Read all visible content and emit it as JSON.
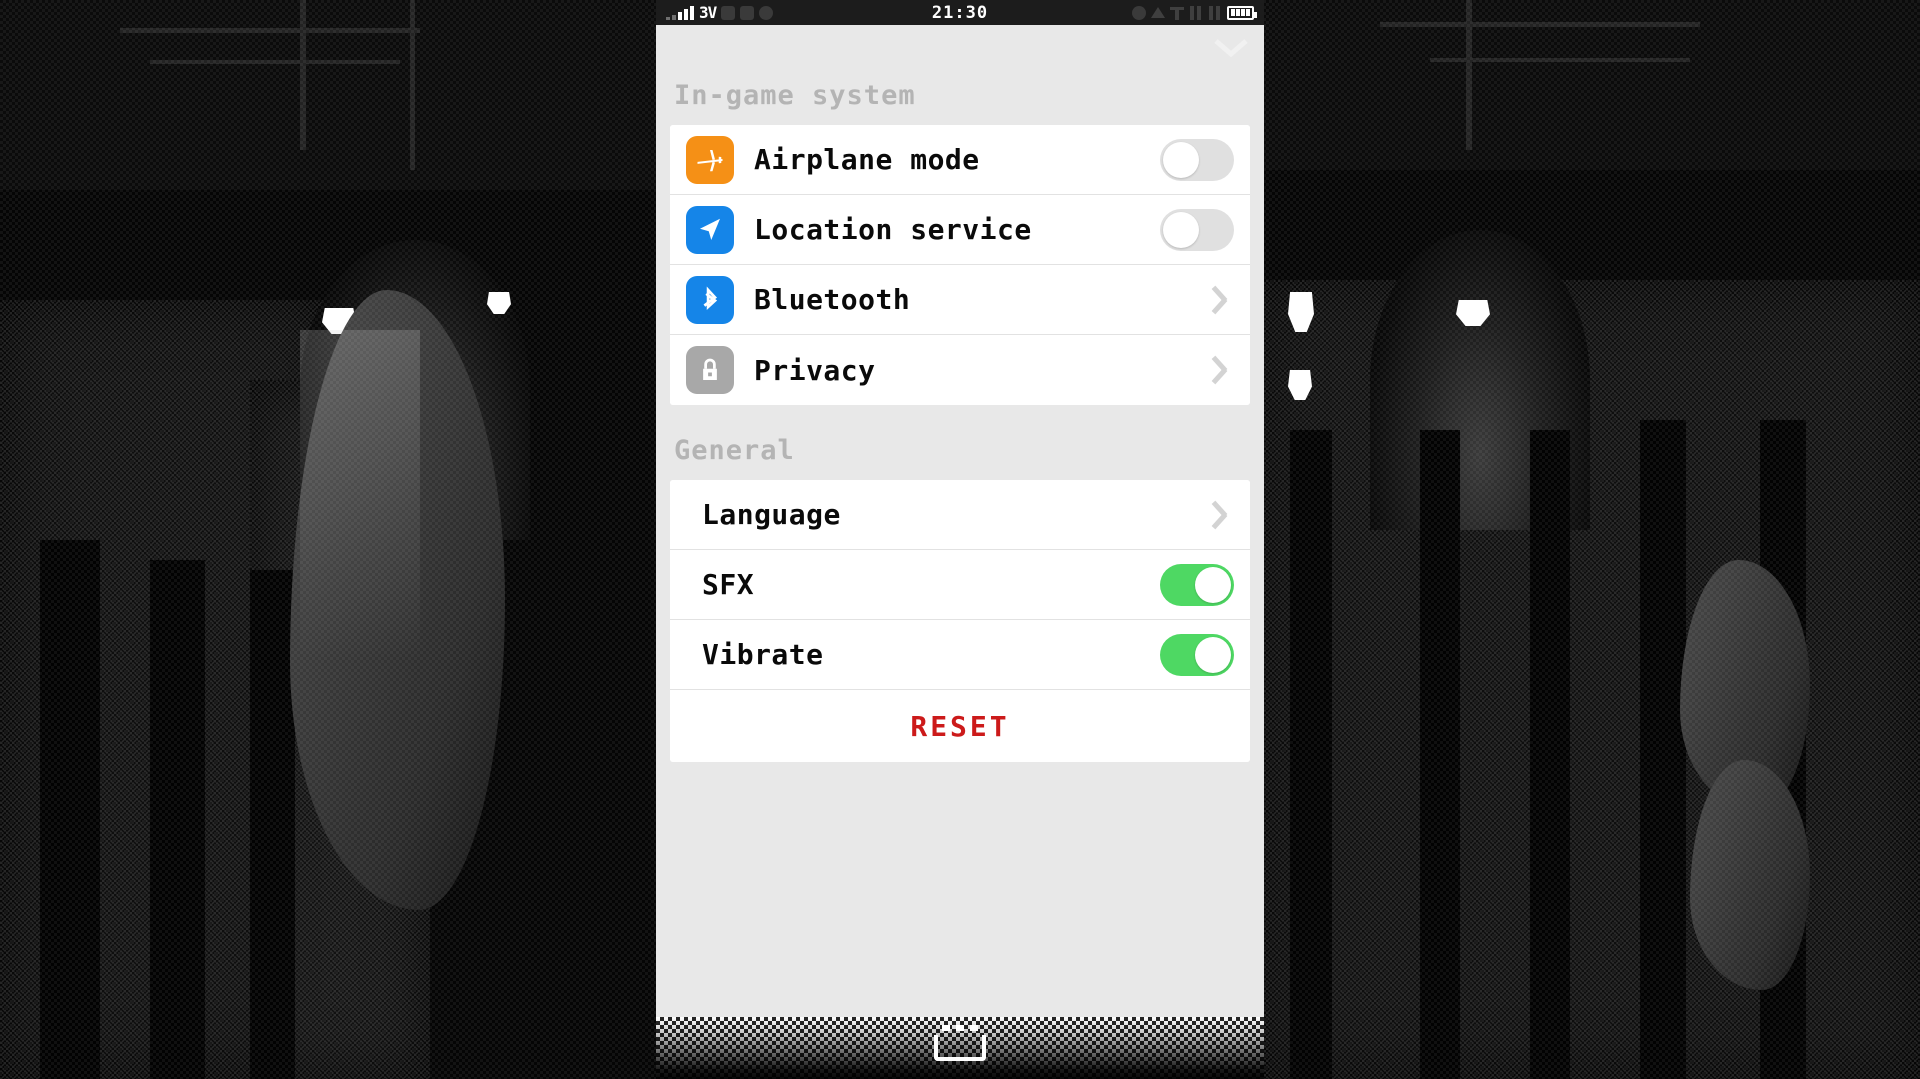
{
  "statusbar": {
    "network_label": "3V",
    "clock": "21:30",
    "signal_icon": "signal-bars-icon",
    "battery_icon": "battery-icon",
    "left_icons": [
      "heart-icon",
      "plus-icon",
      "camera-icon"
    ],
    "right_icons": [
      "circle-icon",
      "triangle-icon",
      "tee-icon",
      "pause-icon",
      "pause-icon"
    ]
  },
  "header": {
    "collapse_icon": "chevron-down-icon"
  },
  "sections": [
    {
      "title": "In-game system",
      "rows": [
        {
          "label": "Airplane mode",
          "icon": "airplane-icon",
          "icon_color": "#f59016",
          "control": "toggle",
          "state": "off"
        },
        {
          "label": "Location service",
          "icon": "location-icon",
          "icon_color": "#1585e8",
          "control": "toggle",
          "state": "off"
        },
        {
          "label": "Bluetooth",
          "icon": "bluetooth-icon",
          "icon_color": "#1585e8",
          "control": "chevron"
        },
        {
          "label": "Privacy",
          "icon": "lock-icon",
          "icon_color": "#a8a8a8",
          "control": "chevron"
        }
      ]
    },
    {
      "title": "General",
      "rows": [
        {
          "label": "Language",
          "icon": null,
          "control": "chevron"
        },
        {
          "label": "SFX",
          "icon": null,
          "control": "toggle",
          "state": "on"
        },
        {
          "label": "Vibrate",
          "icon": null,
          "control": "toggle",
          "state": "on"
        }
      ],
      "reset_label": "RESET"
    }
  ],
  "colors": {
    "toggle_on": "#4ed863",
    "toggle_off": "#e0e0e0",
    "reset_text": "#cc1a1a",
    "panel_bg": "#e8e8e8",
    "card_bg": "#ffffff",
    "section_title": "#b4b4b4"
  },
  "navbar": {
    "home_icon": "home-indicator-icon"
  }
}
